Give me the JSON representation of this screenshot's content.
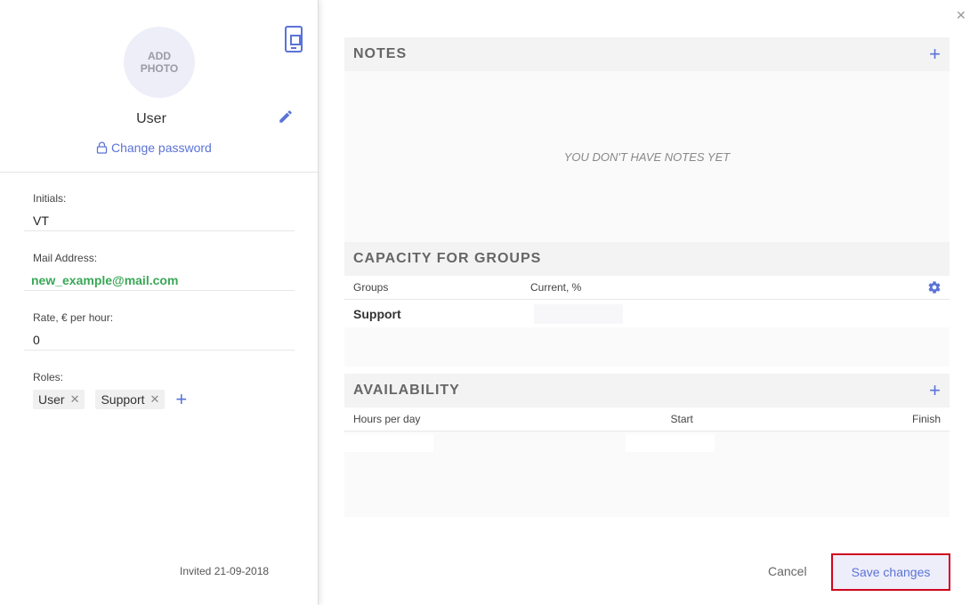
{
  "profile": {
    "add_photo": "ADD PHOTO",
    "name": "User",
    "change_password": "Change password",
    "invited": "Invited 21-09-2018"
  },
  "fields": {
    "initials_label": "Initials:",
    "initials_value": "VT",
    "mail_label": "Mail Address:",
    "mail_value": "new_example@mail.com",
    "rate_label": "Rate, € per hour:",
    "rate_value": "0",
    "roles_label": "Roles:",
    "roles": [
      "User",
      "Support"
    ]
  },
  "notes": {
    "title": "NOTES",
    "empty": "YOU DON'T HAVE NOTES YET"
  },
  "capacity": {
    "title": "CAPACITY FOR GROUPS",
    "col_groups": "Groups",
    "col_current": "Current, %",
    "rows": [
      {
        "group": "Support"
      }
    ]
  },
  "availability": {
    "title": "AVAILABILITY",
    "col_hours": "Hours per day",
    "col_start": "Start",
    "col_finish": "Finish"
  },
  "footer": {
    "cancel": "Cancel",
    "save": "Save changes"
  },
  "colors": {
    "accent": "#5b73d6",
    "email": "#3aa757",
    "highlight": "#d0021b"
  }
}
